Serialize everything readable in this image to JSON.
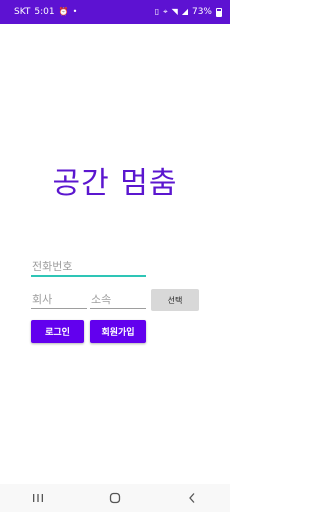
{
  "status_bar": {
    "carrier": "SKT",
    "time": "5:01",
    "battery": "73%"
  },
  "app": {
    "title": "공간 멈춤"
  },
  "form": {
    "phone_placeholder": "전화번호",
    "company_placeholder": "회사",
    "department_placeholder": "소속",
    "select_label": "선택",
    "login_label": "로그인",
    "signup_label": "회원가입"
  },
  "colors": {
    "status_bar": "#5d12d2",
    "accent": "#6200ee",
    "focus_underline": "#2ec5b6"
  },
  "nav_bar": {
    "recent_icon": "recent-apps-icon",
    "home_icon": "home-icon",
    "back_icon": "back-icon"
  }
}
